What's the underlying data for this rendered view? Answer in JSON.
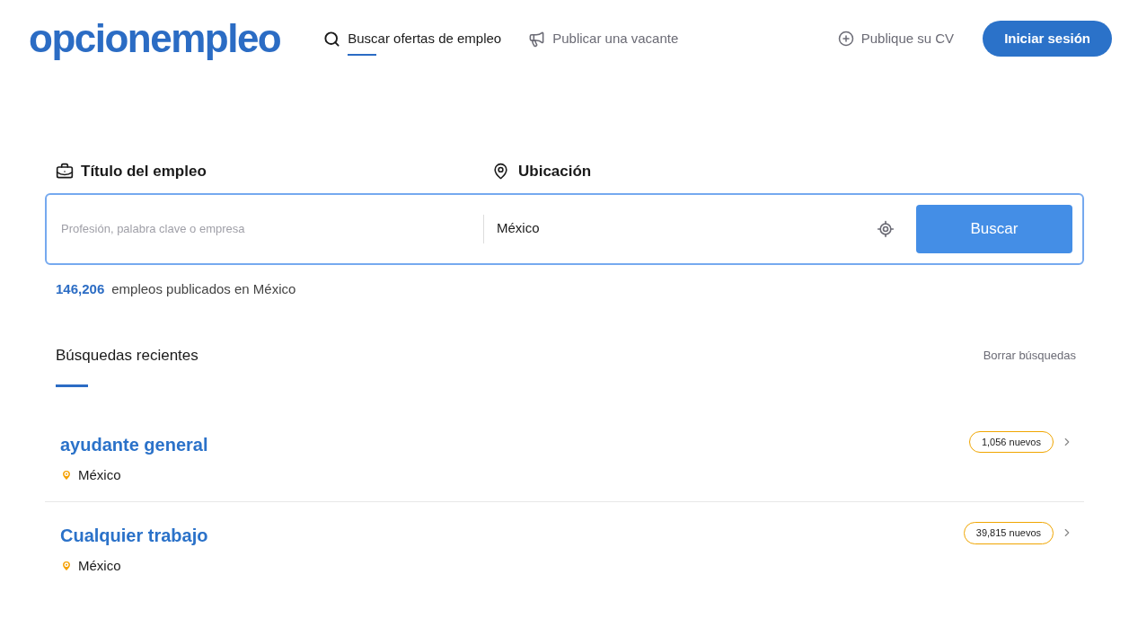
{
  "header": {
    "logo": "opcionempleo",
    "nav": [
      {
        "label": "Buscar ofertas de empleo",
        "selected": true
      },
      {
        "label": "Publicar una vacante",
        "selected": false
      }
    ],
    "post_cv": "Publique su CV",
    "login": "Iniciar sesión"
  },
  "search": {
    "title_label": "Título del empleo",
    "location_label": "Ubicación",
    "placeholder": "Profesión, palabra clave o empresa",
    "location_value": "México",
    "button": "Buscar"
  },
  "job_count": {
    "number": "146,206",
    "text": "empleos publicados en México"
  },
  "recent": {
    "heading": "Búsquedas recientes",
    "clear": "Borrar búsquedas",
    "items": [
      {
        "query": "ayudante general",
        "location": "México",
        "badge": "1,056 nuevos"
      },
      {
        "query": "Cualquier trabajo",
        "location": "México",
        "badge": "39,815 nuevos"
      }
    ]
  }
}
